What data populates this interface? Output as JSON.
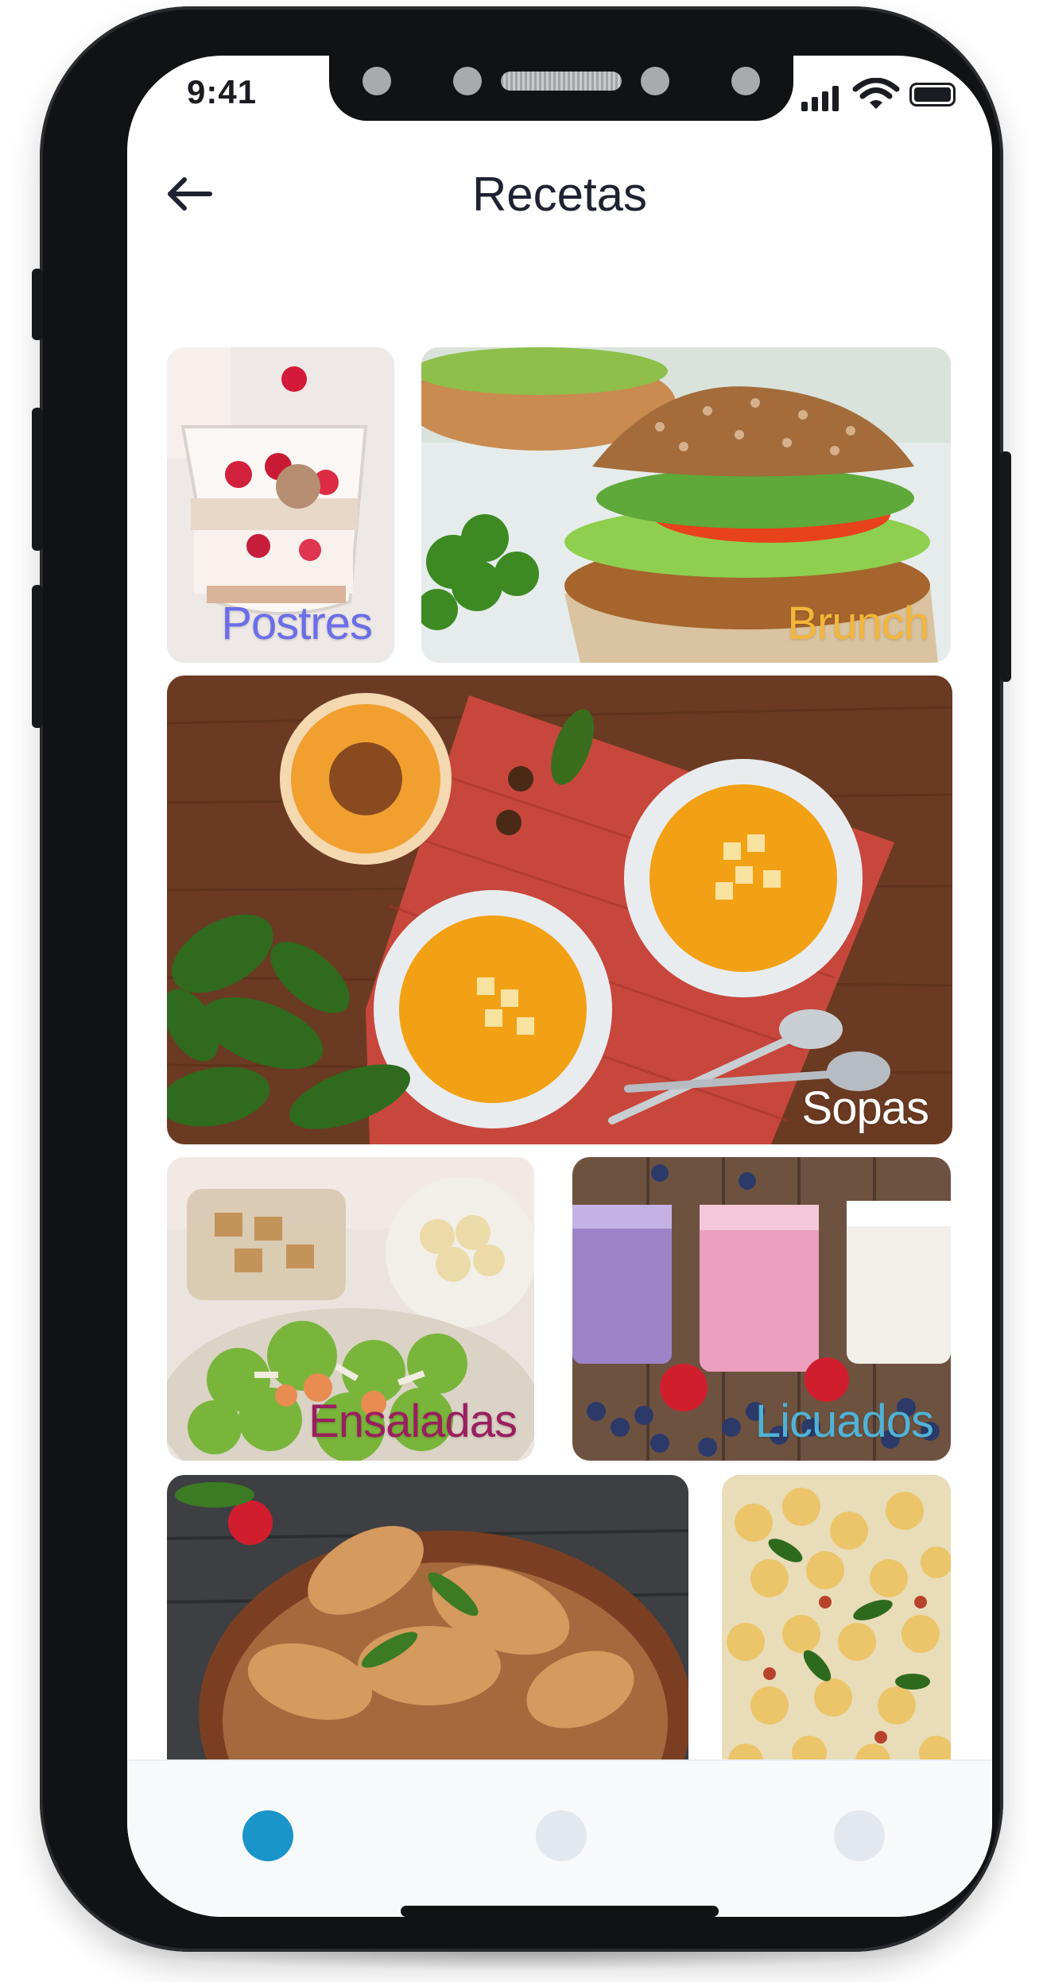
{
  "status_bar": {
    "time": "9:41"
  },
  "header": {
    "title": "Recetas",
    "back_icon": "arrow-left-icon"
  },
  "categories": [
    {
      "label": "Postres",
      "label_color": "#6b6ee8",
      "image": "yogurt-parfait-raspberries"
    },
    {
      "label": "Brunch",
      "label_color": "#f4b63a",
      "image": "seeded-sandwich"
    },
    {
      "label": "Sopas",
      "label_color": "#ffffff",
      "image": "pumpkin-soup-bowls"
    },
    {
      "label": "Ensaladas",
      "label_color": "#9a1f5f",
      "image": "caesar-salad"
    },
    {
      "label": "Licuados",
      "label_color": "#4fb3d6",
      "image": "berry-smoothies"
    },
    {
      "label": "",
      "label_color": "#ffffff",
      "image": "roast-chicken-drumsticks"
    },
    {
      "label": "",
      "label_color": "#ffffff",
      "image": "tortellini-salad"
    }
  ],
  "bottom_nav": {
    "active_color": "#1a95c9",
    "inactive_color": "#e3e7ee",
    "items": [
      {
        "active": true
      },
      {
        "active": false
      },
      {
        "active": false
      }
    ]
  }
}
